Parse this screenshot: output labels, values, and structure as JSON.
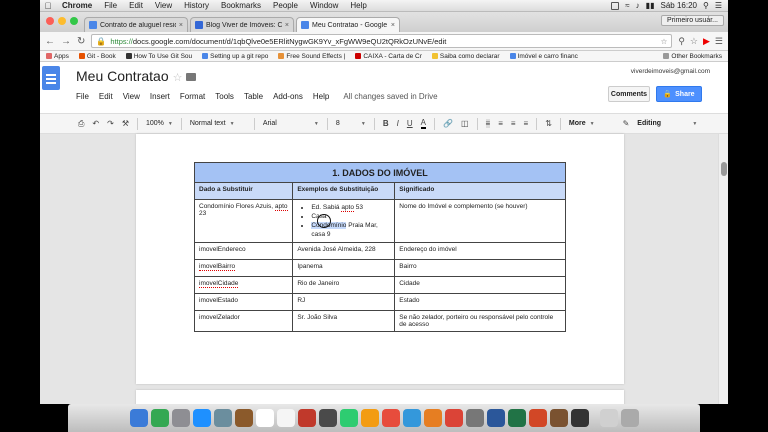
{
  "macbar": {
    "app": "Chrome",
    "items": [
      "File",
      "Edit",
      "View",
      "History",
      "Bookmarks",
      "People",
      "Window",
      "Help"
    ],
    "clock": "Sáb 16:20"
  },
  "tabs": [
    {
      "label": "Contrato de aluguel reside...",
      "color": "#4a86e8"
    },
    {
      "label": "Blog Viver de Imóveis: Co...",
      "color": "#3367d6"
    },
    {
      "label": "Meu Contratao - Google D...",
      "color": "#4a86e8"
    }
  ],
  "profile": "Primeiro usuár...",
  "address": {
    "https": "https://",
    "rest": "docs.google.com/document/d/1qbQlve0e5ERlitNygwGK9Yv_xFgWW9eQU2tQRkOzUNvE/edit"
  },
  "bookmarks": [
    {
      "label": "Apps",
      "color": "#e06666"
    },
    {
      "label": "Git - Book",
      "color": "#e65100"
    },
    {
      "label": "How To Use Git Sou",
      "color": "#333"
    },
    {
      "label": "Setting up a git repo",
      "color": "#4a86e8"
    },
    {
      "label": "Free Sound Effects |",
      "color": "#e69138"
    },
    {
      "label": "CAIXA - Carta de Cr",
      "color": "#cc0000"
    },
    {
      "label": "Saiba como declarar",
      "color": "#f1c232"
    },
    {
      "label": "Imóvel e carro financ",
      "color": "#4a86e8"
    }
  ],
  "other_bookmarks": "Other Bookmarks",
  "doc": {
    "title": "Meu Contratao",
    "menu": [
      "File",
      "Edit",
      "View",
      "Insert",
      "Format",
      "Tools",
      "Table",
      "Add-ons",
      "Help"
    ],
    "saved": "All changes saved in Drive",
    "account": "viverdeimoveis@gmail.com",
    "comments": "Comments",
    "share": "Share"
  },
  "toolbar": {
    "zoom": "100%",
    "style": "Normal text",
    "font": "Arial",
    "size": "8",
    "more": "More",
    "mode": "Editing"
  },
  "table": {
    "title": "1.   DADOS DO IMÓVEL",
    "headers": [
      "Dado a Substituir",
      "Exemplos de Substituição",
      "Significado"
    ],
    "row0": {
      "a": "Condomínio Flores Azuis, ",
      "a_err": "apto",
      "a2": " 23",
      "b_li1a": "Ed. Sabiá ",
      "b_li1_err": "apto",
      "b_li1b": " 53",
      "b_li2": "Casa",
      "b_li3_hl": "Condomínio",
      "b_li3": " Praia Mar, casa 9",
      "c": "Nome do Imóvel e complemento (se houver)"
    },
    "rows": [
      {
        "a": "imovelEndereco",
        "b": "Avenida José Almeida, 228",
        "c": "Endereço do imóvel"
      },
      {
        "a": "imovelBairro",
        "b": "Ipanema",
        "c": "Bairro"
      },
      {
        "a": "imovelCidade",
        "b": "Rio de Janeiro",
        "c": "Cidade"
      },
      {
        "a": "imovelEstado",
        "b": "RJ",
        "c": "Estado"
      },
      {
        "a": "imovelZelador",
        "b": "Sr. João Silva",
        "c": "Se não zelador, porteiro ou responsável pelo controle de acesso"
      }
    ]
  }
}
